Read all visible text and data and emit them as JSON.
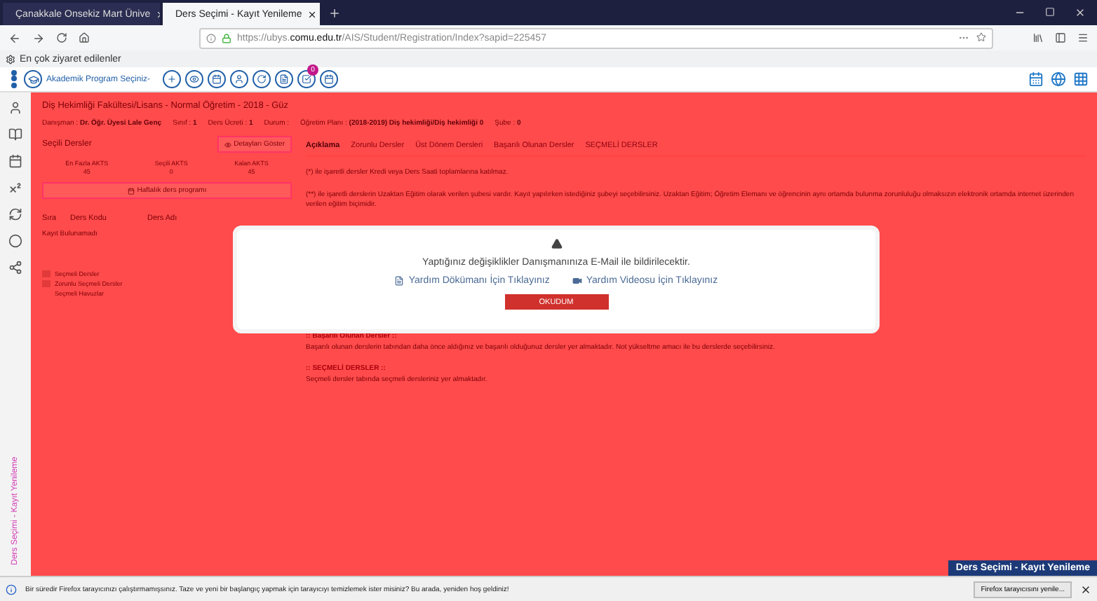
{
  "browser": {
    "tabs": [
      {
        "label": "Çanakkale Onsekiz Mart Ünive",
        "selected": false
      },
      {
        "label": "Ders Seçimi - Kayıt Yenileme",
        "selected": true
      }
    ],
    "url_host": "https://ubys.",
    "url_domain": "comu.edu.tr",
    "url_path": "/AIS/Student/Registration/Index?sapid=225457",
    "bookmark": "En çok ziyaret edilenler"
  },
  "header": {
    "program_select": "Akademik Program Seçiniz-",
    "tools": [
      {
        "kind": "plus"
      },
      {
        "kind": "eye"
      },
      {
        "kind": "calendar"
      },
      {
        "kind": "user"
      },
      {
        "kind": "refresh"
      },
      {
        "kind": "document"
      },
      {
        "kind": "check",
        "badge": "0"
      },
      {
        "kind": "calendar"
      }
    ]
  },
  "info": {
    "faculty": "Diş Hekimliği Fakültesi/Lisans - Normal Öğretim  -  2018 - Güz",
    "details": [
      {
        "label": "Danışman :",
        "value": "Dr. Öğr. Üyesi Lale Genç"
      },
      {
        "label": "Sınıf :",
        "value": "1"
      },
      {
        "label": "Ders Ücreti :",
        "value": "1"
      },
      {
        "label": "Durum :"
      },
      {
        "label": "Öğretim Planı :",
        "value": "(2018-2019) Diş hekimliği/Diş hekimliği 0"
      },
      {
        "label": "Şube :",
        "value": "0"
      }
    ]
  },
  "selected_courses": {
    "title": "Seçili Dersler",
    "details_button": "Detayları Göster",
    "stats": [
      {
        "label": "En Fazla AKTS",
        "value": "45"
      },
      {
        "label": "Seçili AKTS",
        "value": "0"
      },
      {
        "label": "Kalan AKTS",
        "value": "45"
      }
    ],
    "schedule_button": "Haftalık ders programı",
    "columns": [
      "Sıra",
      "Ders Kodu",
      "Ders Adı"
    ],
    "empty": "Kayıt Bulunamadı",
    "legend": [
      {
        "label": "Seçmeli Dersler",
        "color": "#e23a3a"
      },
      {
        "label": "Zorunlu Seçmeli Dersler",
        "color": "#e23a3a"
      },
      {
        "label": "Seçmeli Havuzlar"
      }
    ]
  },
  "tabs": [
    {
      "label": "Açıklama",
      "selected": true
    },
    {
      "label": "Zorunlu Dersler",
      "selected": false
    },
    {
      "label": "Üst Dönem Dersleri",
      "selected": false
    },
    {
      "label": "Başarılı Olunan Dersler",
      "selected": false
    },
    {
      "label": "SEÇMELİ DERSLER",
      "selected": false
    }
  ],
  "notes": [
    "(*) ile işaretli dersler Kredi veya Ders Saati toplamlarına katılmaz.",
    "(**) ile işaretli derslerin Uzaktan Eğitim olarak verilen şubesi vardır. Kayıt yapılırken istediğiniz şubeyi seçebilirsiniz. Uzaktan Eğitim; Öğretim Elemanı ve öğrencinin aynı ortamda bulunma zorunluluğu olmaksızın elektronik ortamda internet üzerinden verilen eğitim biçimidir."
  ],
  "sections": [
    {
      "title": ":: Başarılı Olunan Dersler ::",
      "text": "Başarılı olunan derslerin tabından daha önce aldığınız ve başarılı olduğunuz dersler yer almaktadır. Not yükseltme amacı ile bu derslerde seçebilirsiniz."
    },
    {
      "title": ":: SEÇMELİ DERSLER ::",
      "text": "Seçmeli dersler tabında seçmeli dersleriniz yer almaktadır."
    }
  ],
  "modal": {
    "message": "Yaptığınız değişiklikler Danışmanınıza E-Mail ile bildirilecektir.",
    "links": [
      {
        "kind": "document",
        "label": "Yardım Dökümanı İçin Tıklayınız"
      },
      {
        "kind": "video",
        "label": "Yardım Videosu İçin Tıklayınız"
      }
    ],
    "button": "OKUDUM"
  },
  "side_label": "Ders Seçimi - Kayıt Yenileme",
  "corner_badge": "Ders Seçimi - Kayıt Yenileme",
  "notification": {
    "text": "Bir süredir Firefox tarayıcınızı çalıştırmamışsınız. Taze ve yeni bir başlangıç yapmak için tarayıcıyı temizlemek ister misiniz? Bu arada, yeniden hoş geldiniz!",
    "button": "Firefox tarayıcısını yenile..."
  }
}
